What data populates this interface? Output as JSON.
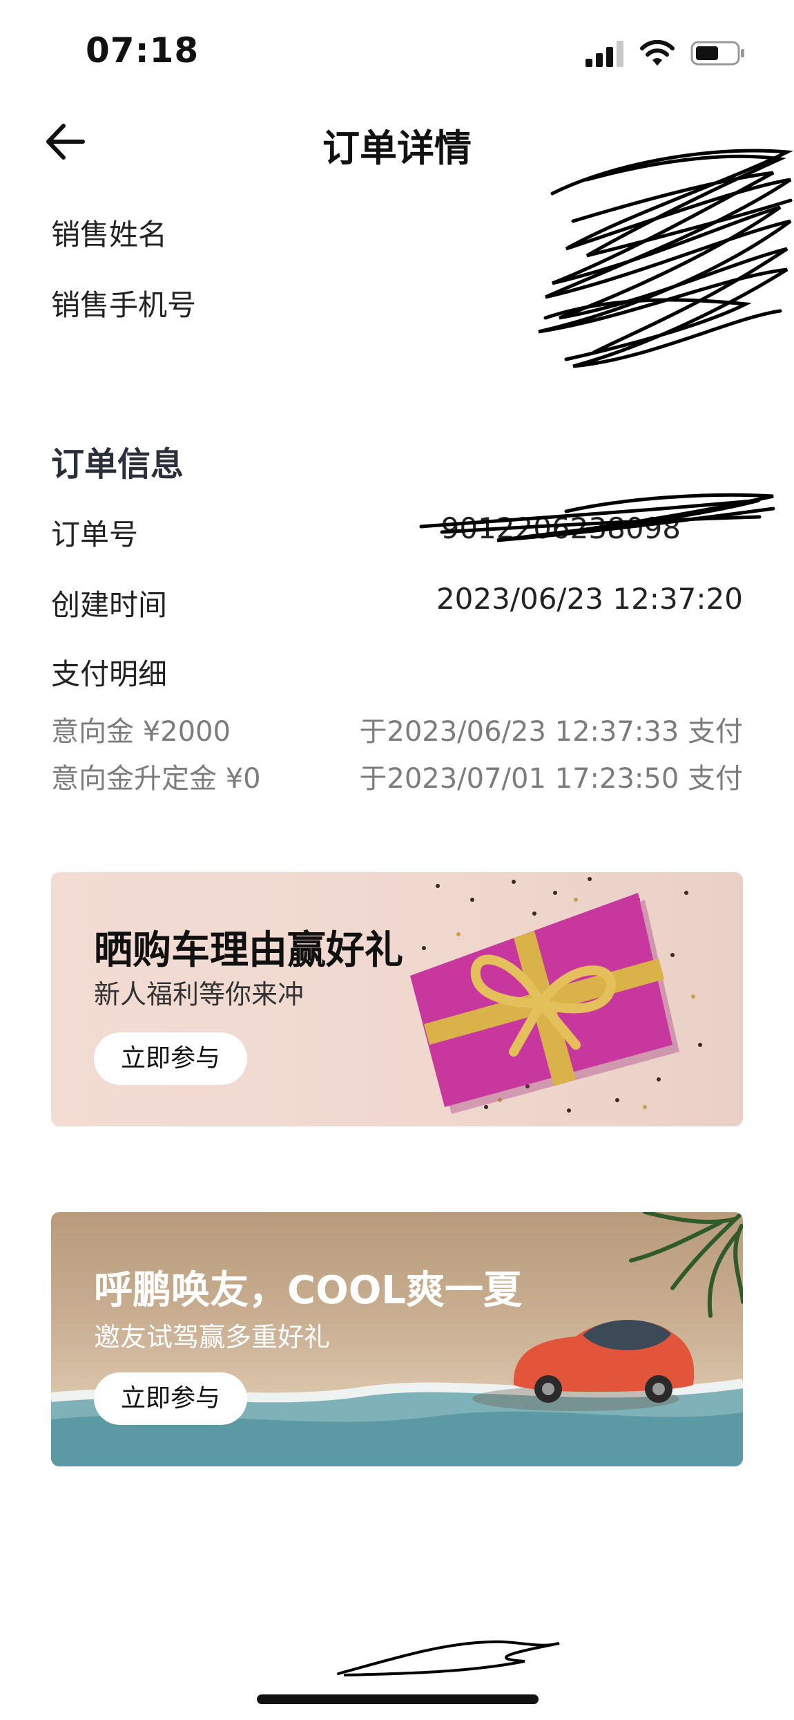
{
  "status_bar": {
    "time": "07:18"
  },
  "header": {
    "title": "订单详情"
  },
  "sales": {
    "name_label": "销售姓名",
    "phone_label": "销售手机号"
  },
  "order_info": {
    "section_title": "订单信息",
    "order_no_label": "订单号",
    "order_no_value": "9012206238098",
    "created_label": "创建时间",
    "created_value": "2023/06/23 12:37:20",
    "payment_title": "支付明细",
    "payments": [
      {
        "left": "意向金 ¥2000",
        "right": "于2023/06/23 12:37:33 支付"
      },
      {
        "left": "意向金升定金 ¥0",
        "right": "于2023/07/01 17:23:50 支付"
      }
    ]
  },
  "banners": [
    {
      "title": "晒购车理由赢好礼",
      "subtitle": "新人福利等你来冲",
      "button": "立即参与"
    },
    {
      "title": "呼鹏唤友，COOL爽一夏",
      "subtitle": "邀友试驾赢多重好礼",
      "button": "立即参与"
    }
  ],
  "colors": {
    "muted_text": "#7c7c7c",
    "gift_box": "#c7379d",
    "ribbon": "#d9b24a",
    "car": "#e2553a"
  }
}
